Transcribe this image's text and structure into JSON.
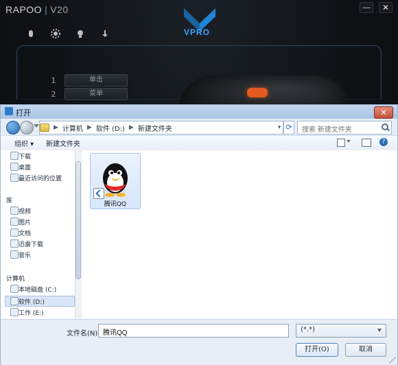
{
  "rapoo": {
    "brand": "RAPOO",
    "model": "V20",
    "vpro": "VPRO",
    "window_controls": {
      "minimize": "—",
      "close": "✕"
    },
    "menu": [
      {
        "index": "1",
        "label": "单击"
      },
      {
        "index": "2",
        "label": "菜单"
      }
    ],
    "colors": {
      "accent": "#3aa6ff",
      "orange": "#e35b1e"
    }
  },
  "dialog": {
    "title": "打开",
    "breadcrumb": [
      "计算机",
      "软件 (D:)",
      "新建文件夹"
    ],
    "search_placeholder": "搜索 新建文件夹",
    "toolbar": {
      "organize": "组织 ▾",
      "new_folder": "新建文件夹"
    },
    "left_pane": {
      "favorites": [
        {
          "label": "下载"
        },
        {
          "label": "桌面"
        },
        {
          "label": "最近访问的位置"
        }
      ],
      "libraries_title": "库",
      "libraries": [
        {
          "label": "视频"
        },
        {
          "label": "图片"
        },
        {
          "label": "文档"
        },
        {
          "label": "迅雷下载"
        },
        {
          "label": "音乐"
        }
      ],
      "computer_title": "计算机",
      "drives": [
        {
          "label": "本地磁盘 (C:)"
        },
        {
          "label": "软件 (D:)"
        },
        {
          "label": "工作 (E:)"
        }
      ]
    },
    "files": [
      {
        "name": "腾讯QQ"
      }
    ],
    "filename_label": "文件名(N):",
    "filename_value": "腾讯QQ",
    "file_type_value": "(*.*)",
    "open_button": "打开(O)",
    "cancel_button": "取消"
  }
}
